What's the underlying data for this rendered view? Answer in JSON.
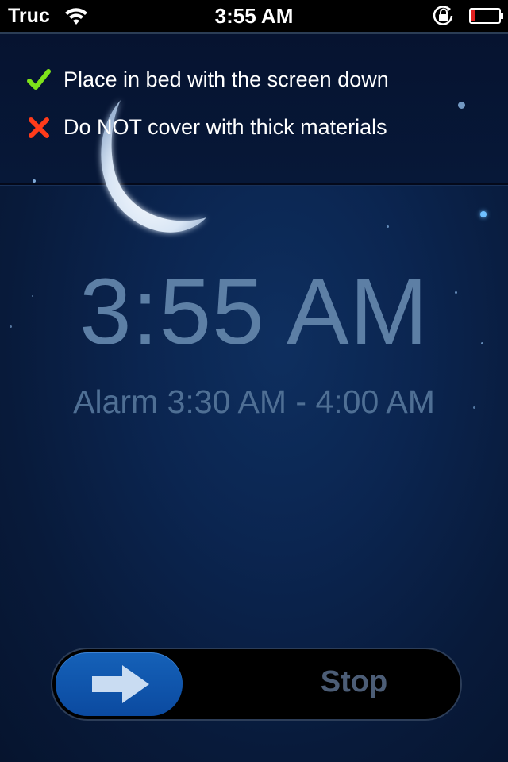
{
  "status_bar": {
    "carrier": "Truc",
    "time": "3:55 AM",
    "battery_level": 0.15,
    "battery_color": "#e02020"
  },
  "instructions": [
    {
      "icon": "check-icon",
      "text": "Place in bed with the screen down",
      "icon_color": "#7ee21a"
    },
    {
      "icon": "cross-icon",
      "text": "Do NOT cover with thick materials",
      "icon_color": "#ff3b1a"
    }
  ],
  "main": {
    "current_time": "3:55 AM",
    "alarm_range": "Alarm 3:30 AM - 4:00 AM"
  },
  "slider": {
    "label": "Stop",
    "knob_icon": "arrow-right-icon",
    "knob_color": "#1561b8"
  },
  "colors": {
    "background": "#0b2550",
    "time_text": "#5d7fa5"
  }
}
